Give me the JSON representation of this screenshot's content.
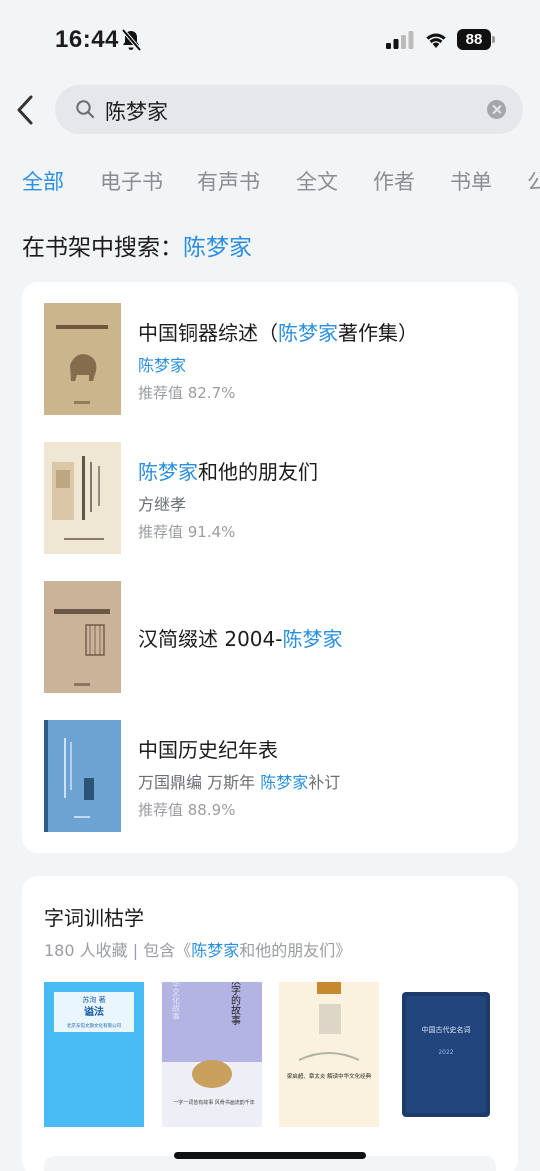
{
  "status": {
    "time": "16:44",
    "battery": "88"
  },
  "search": {
    "query": "陈梦家"
  },
  "tabs": [
    "全部",
    "电子书",
    "有声书",
    "全文",
    "作者",
    "书单",
    "公"
  ],
  "shelf_search": {
    "prefix": "在书架中搜索：",
    "keyword": "陈梦家"
  },
  "books": [
    {
      "title_pre": "中国铜器综述（",
      "title_hl": "陈梦家",
      "title_post": "著作集）",
      "author": "陈梦家",
      "score": "推荐值 82.7%"
    },
    {
      "title_pre": "",
      "title_hl": "陈梦家",
      "title_post": "和他的朋友们",
      "author": "方继孝",
      "score": "推荐值 91.4%"
    },
    {
      "title_pre": "汉简缀述 2004-",
      "title_hl": "陈梦家",
      "title_post": ""
    },
    {
      "title_pre": "中国历史纪年表",
      "title_hl": "",
      "title_post": "",
      "author_pre": "万国鼎编 万斯年 ",
      "author_hl": "陈梦家",
      "author_post": "补订",
      "score": "推荐值 88.9%"
    }
  ],
  "booklist": {
    "title": "字词训枯学",
    "meta_pre": "180 人收藏 | 包含《",
    "meta_hl": "陈梦家",
    "meta_post": "和他的朋友们》",
    "covers": [
      {
        "author": "苏洵 著",
        "title": "谥法",
        "publisher": "北京东馆文旗文化有限公司"
      },
      {
        "series": "中华文化故事",
        "title": "汉字的故事",
        "sub": "一字一词皆有故事 风骨书画流韵千年"
      },
      {
        "title": "梁启超、章太炎 解读中华文化经典"
      },
      {
        "title": "中国古代史名词",
        "year": "2022"
      }
    ]
  },
  "colors": {
    "accent": "#2a8fe0",
    "background": "#f3f4f6"
  }
}
